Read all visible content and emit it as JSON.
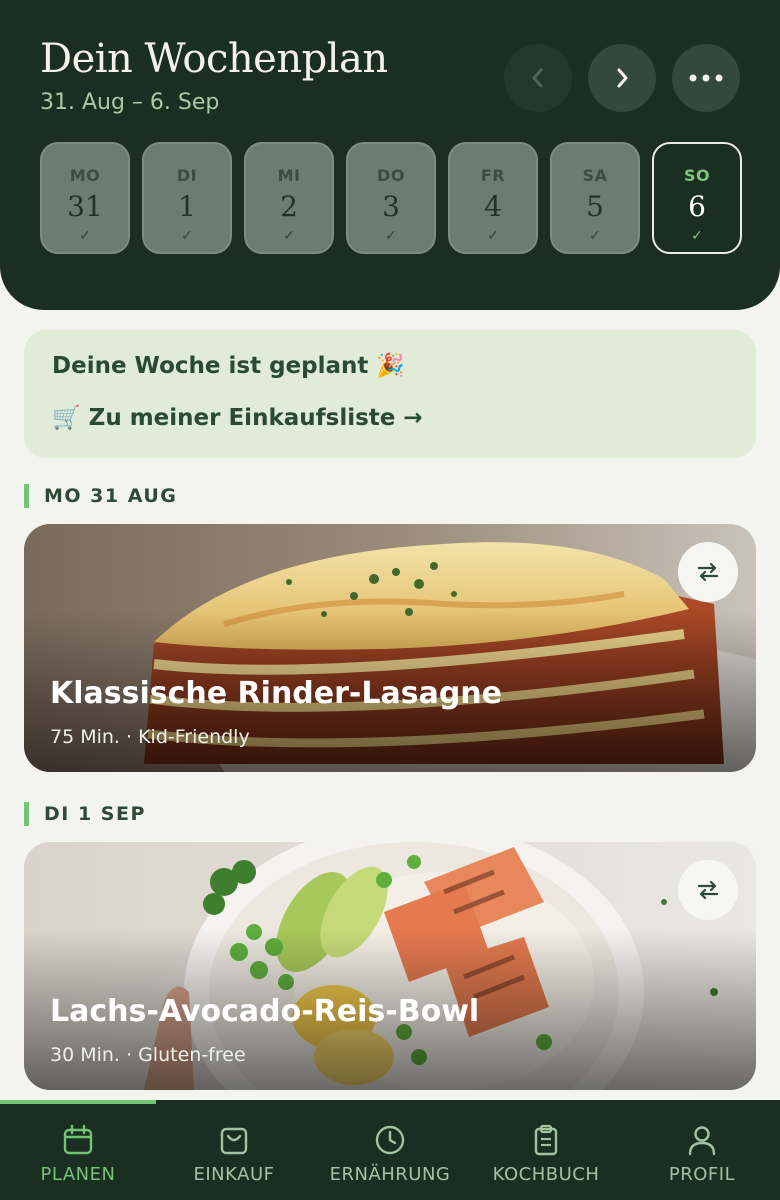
{
  "header": {
    "title": "Dein Wochenplan",
    "date_range": "31. Aug – 6. Sep",
    "prev_icon": "chevron-left-icon",
    "next_icon": "chevron-right-icon",
    "more_icon": "more-horizontal-icon"
  },
  "days": [
    {
      "name": "MO",
      "num": "31",
      "check": "✓"
    },
    {
      "name": "DI",
      "num": "1",
      "check": "✓"
    },
    {
      "name": "MI",
      "num": "2",
      "check": "✓"
    },
    {
      "name": "DO",
      "num": "3",
      "check": "✓"
    },
    {
      "name": "FR",
      "num": "4",
      "check": "✓"
    },
    {
      "name": "SA",
      "num": "5",
      "check": "✓"
    },
    {
      "name": "SO",
      "num": "6",
      "check": "✓"
    }
  ],
  "banner": {
    "message": "Deine Woche ist geplant 🎉",
    "cart_icon": "🛒",
    "link": "Zu meiner Einkaufsliste →"
  },
  "sections": [
    {
      "label": "MO 31 AUG",
      "recipe": {
        "title": "Klassische Rinder-Lasagne",
        "meta": "75 Min. · Kid-Friendly"
      }
    },
    {
      "label": "DI 1 SEP",
      "recipe": {
        "title": "Lachs-Avocado-Reis-Bowl",
        "meta": "30 Min. · Gluten-free"
      }
    }
  ],
  "nav": {
    "items": [
      {
        "label": "PLANEN",
        "icon": "calendar-icon"
      },
      {
        "label": "EINKAUF",
        "icon": "shopping-bag-icon"
      },
      {
        "label": "ERNÄHRUNG",
        "icon": "clock-icon"
      },
      {
        "label": "KOCHBUCH",
        "icon": "clipboard-icon"
      },
      {
        "label": "PROFIL",
        "icon": "user-icon"
      }
    ],
    "active": "PLANEN"
  },
  "colors": {
    "header_bg": "#1b2e22",
    "accent": "#74c476",
    "banner_bg": "#e0ecd8",
    "page_bg": "#f3f4ee"
  }
}
